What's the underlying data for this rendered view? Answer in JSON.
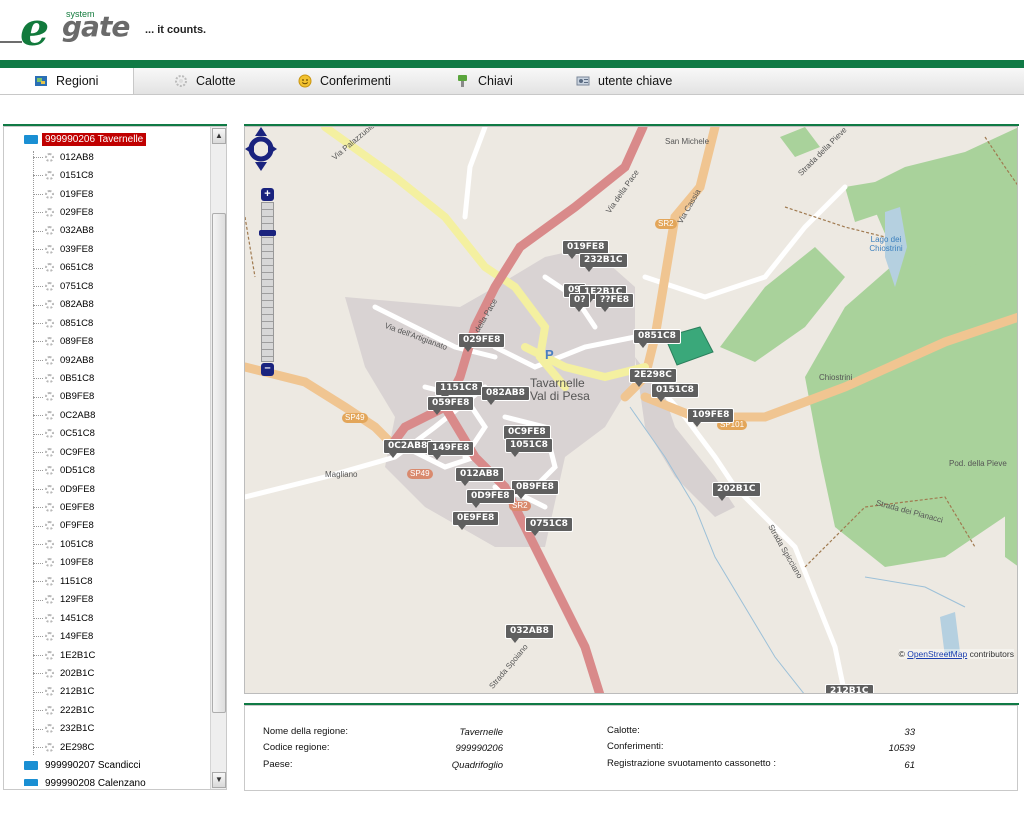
{
  "header": {
    "logo_system": "system",
    "logo_e": "e",
    "logo_gate": "gate",
    "tagline": "... it counts."
  },
  "tabs": [
    {
      "label": "Regioni",
      "icon": "map-icon",
      "active": true
    },
    {
      "label": "Calotte",
      "icon": "gear-icon",
      "active": false
    },
    {
      "label": "Conferimenti",
      "icon": "smiley-icon",
      "active": false
    },
    {
      "label": "Chiavi",
      "icon": "key-icon",
      "active": false
    },
    {
      "label": "utente chiave",
      "icon": "user-key-icon",
      "active": false
    }
  ],
  "tree": {
    "roots": [
      {
        "label": "999990206 Tavernelle",
        "selected": true
      },
      {
        "label": "999990207 Scandicci",
        "selected": false
      },
      {
        "label": "999990208 Calenzano",
        "selected": false
      }
    ],
    "children": [
      "012AB8",
      "0151C8",
      "019FE8",
      "029FE8",
      "032AB8",
      "039FE8",
      "0651C8",
      "0751C8",
      "082AB8",
      "0851C8",
      "089FE8",
      "092AB8",
      "0B51C8",
      "0B9FE8",
      "0C2AB8",
      "0C51C8",
      "0C9FE8",
      "0D51C8",
      "0D9FE8",
      "0E9FE8",
      "0F9FE8",
      "1051C8",
      "109FE8",
      "1151C8",
      "129FE8",
      "1451C8",
      "149FE8",
      "1E2B1C",
      "202B1C",
      "212B1C",
      "222B1C",
      "232B1C",
      "2E298C"
    ]
  },
  "map": {
    "markers": [
      "019FE8",
      "232B1C",
      "09",
      "1E2B1C",
      "0?",
      "??FE8",
      "0851C8",
      "029FE8",
      "2E298C",
      "1151C8",
      "0151C8",
      "082AB8",
      "059FE8",
      "109FE8",
      "0C9FE8",
      "0C2AB8",
      "149FE8",
      "1051C8",
      "012AB8",
      "0B9FE8",
      "202B1C",
      "0D9FE8",
      "0E9FE8",
      "0751C8",
      "032AB8",
      "212B1C"
    ],
    "labels": {
      "town": "Tavarnelle Val di Pesa",
      "san_michele": "San Michele",
      "lago": "Lago dei Chiostrini",
      "chiostrini": "Chiostrini",
      "pod_pieve": "Pod. della Pieve",
      "magliano": "Magliano",
      "via_della_pace": "Via della Pace",
      "via_cassia": "Via Cassia",
      "strada_pieve": "Strada della Pieve",
      "strada_spicciano": "Strada Spicciano",
      "strada_pianacci": "Strada dei Pianacci",
      "strada_spoiano": "Strada Spoiano",
      "via_palazzuolo": "Via Palazzuolo",
      "via_artigianato": "Via dell'Artigianato",
      "p": "P"
    },
    "road_labels": [
      "SR2",
      "SP49",
      "SP49",
      "SR2",
      "SP101"
    ],
    "attribution_symbol": "©",
    "attribution_link": "OpenStreetMap",
    "attribution_rest": " contributors",
    "zoom_plus": "+",
    "zoom_minus": "–"
  },
  "info": {
    "nome_label": "Nome della regione:",
    "nome_value": "Tavernelle",
    "codice_label": "Codice regione:",
    "codice_value": "999990206",
    "paese_label": "Paese:",
    "paese_value": "Quadrifoglio",
    "calotte_label": "Calotte:",
    "calotte_value": "33",
    "conferimenti_label": "Conferimenti:",
    "conferimenti_value": "10539",
    "registrazione_label": "Registrazione svuotamento cassonetto :",
    "registrazione_value": "61"
  },
  "colors": {
    "brand_green": "#107a45",
    "selection_red": "#c00000",
    "marker_gray": "#5f5f5f",
    "folder_blue": "#1a8fd3"
  }
}
